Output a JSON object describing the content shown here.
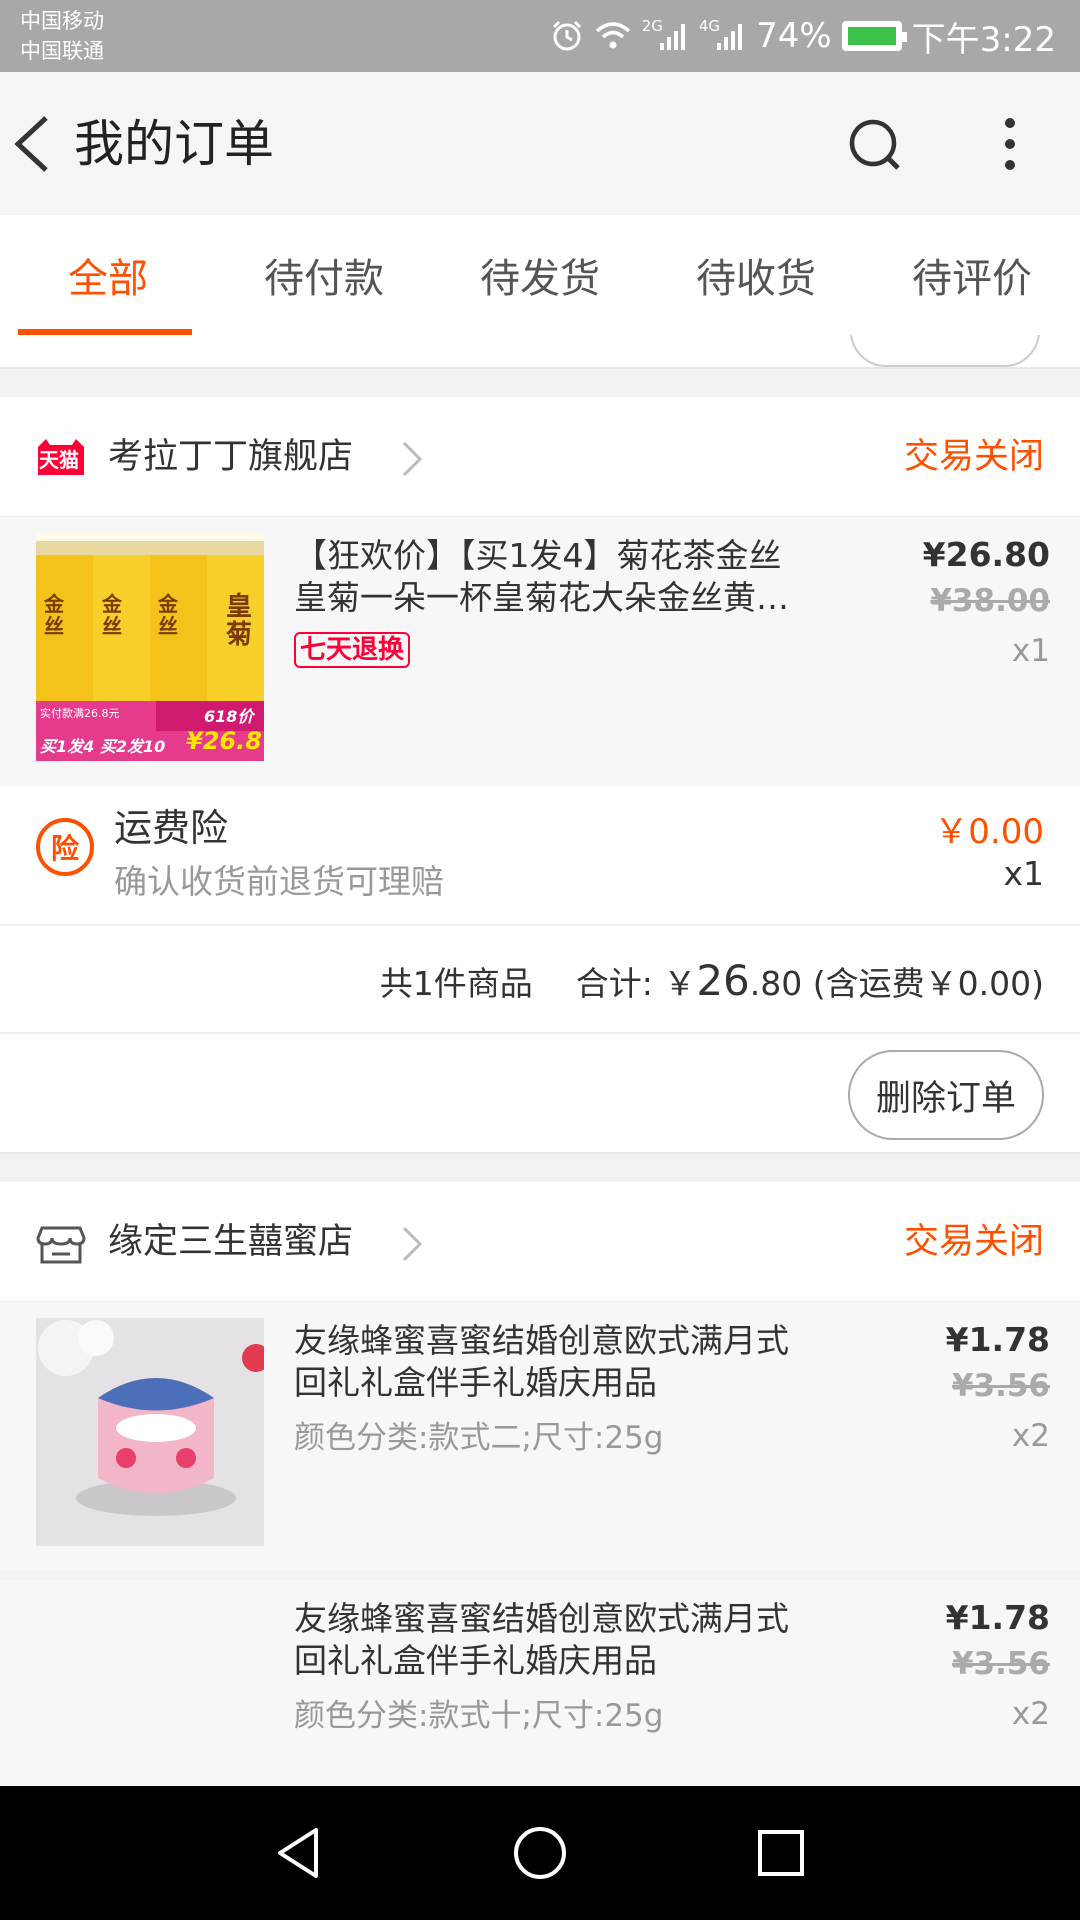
{
  "status_bar": {
    "carrier1": "中国移动",
    "carrier2": "中国联通",
    "net1": "2G",
    "net2": "4G",
    "battery": "74%",
    "time": "下午3:22"
  },
  "header": {
    "title": "我的订单"
  },
  "tabs": [
    {
      "label": "全部"
    },
    {
      "label": "待付款"
    },
    {
      "label": "待发货"
    },
    {
      "label": "待收货"
    },
    {
      "label": "待评价"
    }
  ],
  "orders": [
    {
      "shop_badge": "天猫",
      "shop_name": "考拉丁丁旗舰店",
      "status": "交易关闭",
      "item": {
        "title_line1": "【狂欢价】【买1发4】菊花茶金丝",
        "title_line2": "皇菊一朵一杯皇菊花大朵金丝黄…",
        "badge": "七天退换",
        "price": "¥26.80",
        "original_price": "¥38.00",
        "qty": "x1",
        "thumb": {
          "can_label": "皇菊",
          "can_brand": "金丝",
          "banner_left": "买1发4 买2发10",
          "banner_price": "¥26.8",
          "banner_tag": "618价",
          "banner_small": "实付款满26.8元"
        }
      },
      "insurance": {
        "icon": "险",
        "name": "运费险",
        "desc": "确认收货前退货可理赔",
        "price": "￥0.00",
        "qty": "x1"
      },
      "summary": {
        "count": "共1件商品",
        "total_label": "合计: ￥",
        "total_int": "26",
        "total_dec": ".80",
        "shipping": "(含运费￥0.00)"
      },
      "action": "删除订单"
    },
    {
      "shop_name": "缘定三生囍蜜店",
      "status": "交易关闭",
      "items": [
        {
          "title_line1": "友缘蜂蜜喜蜜结婚创意欧式满月式",
          "title_line2": "回礼礼盒伴手礼婚庆用品",
          "sku": "颜色分类:款式二;尺寸:25g",
          "price": "¥1.78",
          "original_price": "¥3.56",
          "qty": "x2"
        },
        {
          "title_line1": "友缘蜂蜜喜蜜结婚创意欧式满月式",
          "title_line2": "回礼礼盒伴手礼婚庆用品",
          "sku": "颜色分类:款式十;尺寸:25g",
          "price": "¥1.78",
          "original_price": "¥3.56",
          "qty": "x2"
        }
      ]
    }
  ],
  "colors": {
    "accent": "#ff5000",
    "tmall_red": "#ff0036",
    "status_bar": "#a8a8a8"
  }
}
